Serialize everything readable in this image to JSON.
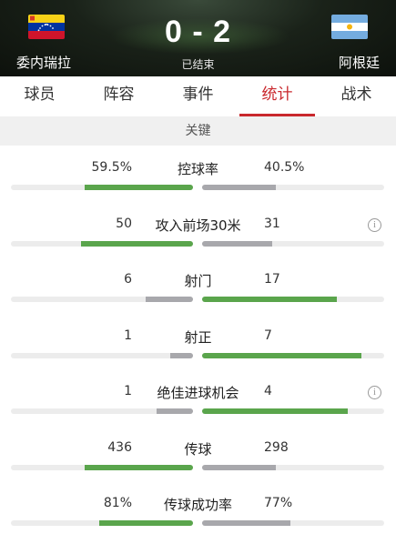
{
  "header": {
    "home_team": "委内瑞拉",
    "away_team": "阿根廷",
    "score": "0 - 2",
    "status": "已结束"
  },
  "tabs": [
    {
      "label": "球员",
      "active": false
    },
    {
      "label": "阵容",
      "active": false
    },
    {
      "label": "事件",
      "active": false
    },
    {
      "label": "统计",
      "active": true
    },
    {
      "label": "战术",
      "active": false
    }
  ],
  "section_title": "关键",
  "colors": {
    "accent": "#c9282d",
    "leading_bar": "#5aa54c",
    "trailing_bar": "#a8a8ac",
    "track": "#ececec"
  },
  "stats": [
    {
      "label": "控球率",
      "home": "59.5%",
      "away": "40.5%",
      "home_value": 59.5,
      "away_value": 40.5,
      "info": false
    },
    {
      "label": "攻入前场30米",
      "home": "50",
      "away": "31",
      "home_value": 50,
      "away_value": 31,
      "info": true
    },
    {
      "label": "射门",
      "home": "6",
      "away": "17",
      "home_value": 6,
      "away_value": 17,
      "info": false
    },
    {
      "label": "射正",
      "home": "1",
      "away": "7",
      "home_value": 1,
      "away_value": 7,
      "info": false
    },
    {
      "label": "绝佳进球机会",
      "home": "1",
      "away": "4",
      "home_value": 1,
      "away_value": 4,
      "info": true
    },
    {
      "label": "传球",
      "home": "436",
      "away": "298",
      "home_value": 436,
      "away_value": 298,
      "info": false
    },
    {
      "label": "传球成功率",
      "home": "81%",
      "away": "77%",
      "home_value": 81,
      "away_value": 77,
      "info": false
    }
  ]
}
